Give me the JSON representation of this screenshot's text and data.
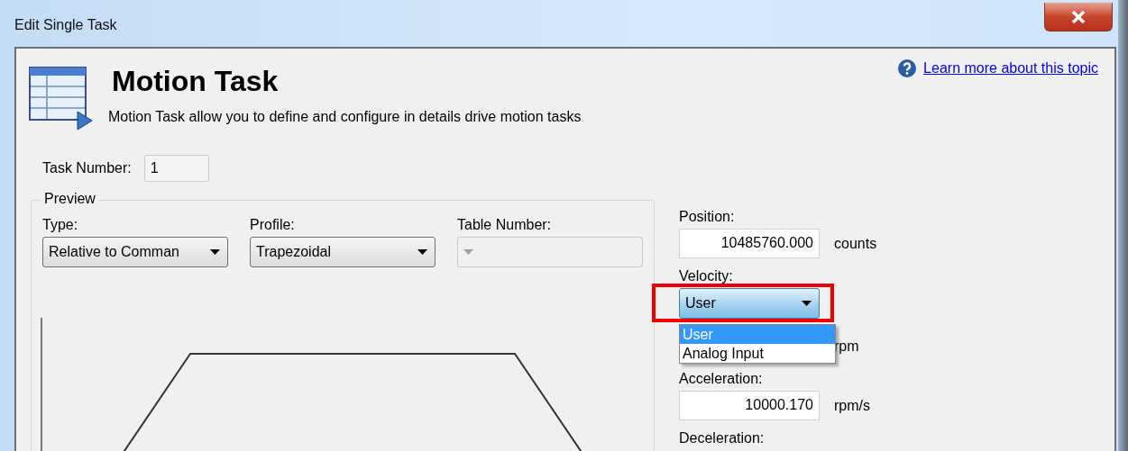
{
  "window": {
    "title": "Edit Single Task"
  },
  "header": {
    "title": "Motion Task",
    "subtitle": "Motion Task allow you to define and configure in details drive motion tasks",
    "help_link": "Learn more about this topic"
  },
  "task_number": {
    "label": "Task Number:",
    "value": "1"
  },
  "preview": {
    "title": "Preview",
    "fields": [
      {
        "label": "Type:",
        "value": "Relative to Comman",
        "disabled": false
      },
      {
        "label": "Profile:",
        "value": "Trapezoidal",
        "disabled": false
      },
      {
        "label": "Table Number:",
        "disabled": true
      }
    ]
  },
  "parameters": [
    {
      "kind": "field",
      "label": "Position:",
      "value": "10485760.000",
      "unit": "counts"
    },
    {
      "kind": "dropdown",
      "label": "Velocity:",
      "value": "User",
      "expanded": true,
      "highlighted": true,
      "unit": "rpm",
      "options": [
        {
          "label": "User",
          "selected": true
        },
        {
          "label": "Analog Input",
          "selected": false
        }
      ]
    },
    {
      "kind": "field",
      "label": "Acceleration:",
      "value": "10000.170",
      "unit": "rpm/s"
    },
    {
      "kind": "label",
      "label": "Deceleration:"
    }
  ]
}
